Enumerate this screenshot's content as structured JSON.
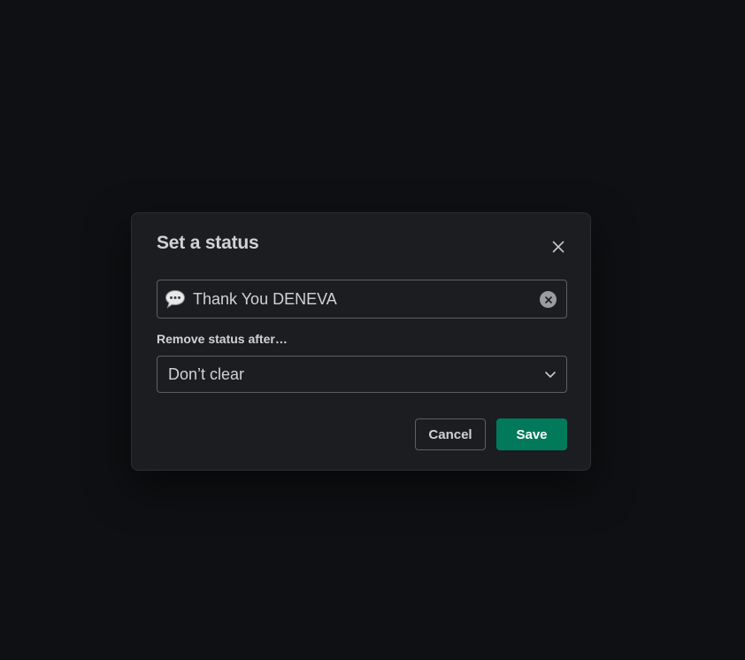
{
  "modal": {
    "title": "Set a status",
    "status": {
      "emoji_icon": "speech-balloon-icon",
      "value": "Thank You DENEVA",
      "clear_icon": "clear-x-icon"
    },
    "expiry": {
      "label": "Remove status after…",
      "selected": "Don’t clear",
      "dropdown_icon": "chevron-down-icon"
    },
    "actions": {
      "cancel_label": "Cancel",
      "save_label": "Save"
    },
    "close_icon": "close-icon"
  },
  "colors": {
    "background": "#0f1013",
    "modal_bg": "#1b1d21",
    "text": "#d1d2d3",
    "border": "#5d5f63",
    "save_button": "#007a5a"
  }
}
